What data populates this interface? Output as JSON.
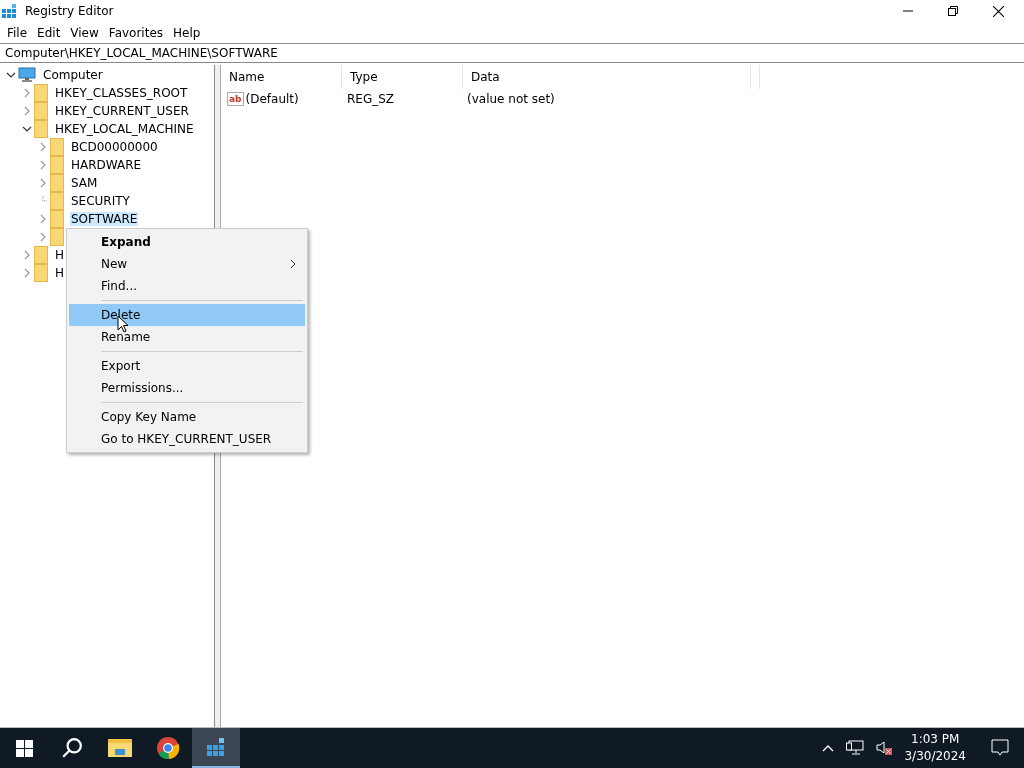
{
  "window": {
    "title": "Registry Editor"
  },
  "menu_bar": [
    "File",
    "Edit",
    "View",
    "Favorites",
    "Help"
  ],
  "address": "Computer\\HKEY_LOCAL_MACHINE\\SOFTWARE",
  "tree": [
    {
      "label": "Computer",
      "kind": "computer",
      "expandable": true,
      "expanded": true,
      "selected": false,
      "children": [
        {
          "label": "HKEY_CLASSES_ROOT",
          "kind": "folder",
          "expandable": true,
          "selected": false
        },
        {
          "label": "HKEY_CURRENT_USER",
          "kind": "folder",
          "expandable": true,
          "selected": false
        },
        {
          "label": "HKEY_LOCAL_MACHINE",
          "kind": "folder",
          "expandable": true,
          "expanded": true,
          "selected": false,
          "children": [
            {
              "label": "BCD00000000",
              "kind": "folder",
              "expandable": true,
              "selected": false
            },
            {
              "label": "HARDWARE",
              "kind": "folder",
              "expandable": true,
              "selected": false
            },
            {
              "label": "SAM",
              "kind": "folder",
              "expandable": true,
              "selected": false
            },
            {
              "label": "SECURITY",
              "kind": "folder",
              "expandable": false,
              "selected": false
            },
            {
              "label": "SOFTWARE",
              "kind": "folder",
              "expandable": true,
              "selected": true
            },
            {
              "kind": "folder",
              "expandable": true
            }
          ]
        },
        {
          "label": "H",
          "kind": "folder",
          "expandable": true,
          "selected": false
        },
        {
          "label": "H",
          "kind": "folder",
          "expandable": true,
          "selected": false
        }
      ]
    }
  ],
  "values_table": {
    "columns": [
      "Name",
      "Type",
      "Data"
    ],
    "rows": [
      {
        "icon_text": "ab",
        "name": "(Default)",
        "type": "REG_SZ",
        "data": "(value not set)"
      }
    ]
  },
  "context_menu": [
    {
      "kind": "item",
      "label": "Expand",
      "default": true,
      "submenu": false,
      "selected": false
    },
    {
      "kind": "item",
      "label": "New",
      "default": false,
      "submenu": true,
      "selected": false
    },
    {
      "kind": "item",
      "label": "Find...",
      "default": false,
      "submenu": false,
      "selected": false
    },
    {
      "kind": "separator"
    },
    {
      "kind": "item",
      "label": "Delete",
      "default": false,
      "submenu": false,
      "selected": true
    },
    {
      "kind": "item",
      "label": "Rename",
      "default": false,
      "submenu": false,
      "selected": false
    },
    {
      "kind": "separator"
    },
    {
      "kind": "item",
      "label": "Export",
      "default": false,
      "submenu": false,
      "selected": false
    },
    {
      "kind": "item",
      "label": "Permissions...",
      "default": false,
      "submenu": false,
      "selected": false
    },
    {
      "kind": "separator"
    },
    {
      "kind": "item",
      "label": "Copy Key Name",
      "default": false,
      "submenu": false,
      "selected": false
    },
    {
      "kind": "item",
      "label": "Go to HKEY_CURRENT_USER",
      "default": false,
      "submenu": false,
      "selected": false
    }
  ],
  "taskbar": {
    "apps": [
      {
        "kind": "start",
        "selected": false
      },
      {
        "kind": "search",
        "selected": false
      },
      {
        "kind": "explorer",
        "selected": false
      },
      {
        "kind": "browser",
        "selected": false
      },
      {
        "kind": "regedit",
        "selected": true
      }
    ],
    "time": "1:03 PM",
    "date": "3/30/2024"
  }
}
